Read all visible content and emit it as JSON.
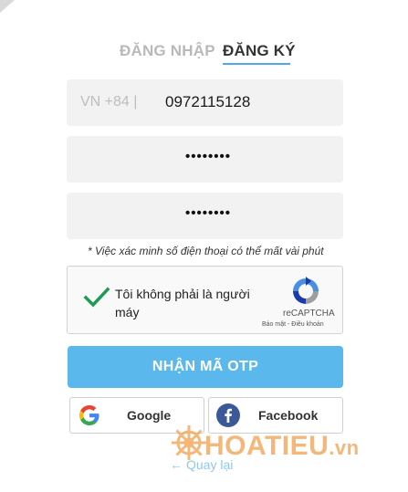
{
  "tabs": [
    {
      "label": "ĐĂNG NHẬP"
    },
    {
      "label": "ĐĂNG KÝ"
    }
  ],
  "phone": {
    "prefix": "VN +84 |",
    "value": "0972115128"
  },
  "password": {
    "masked": "••••••••"
  },
  "confirm_password": {
    "masked": "••••••••"
  },
  "note": "* Việc xác minh số điện thoại có thể mất vài phút",
  "captcha": {
    "label": "Tôi không phải là người máy",
    "brand": "reCAPTCHA",
    "links": "Bảo mật - Điều khoản"
  },
  "otp_button": "NHẬN MÃ OTP",
  "social": {
    "google": "Google",
    "facebook": "Facebook"
  },
  "back_link": "Quay lại",
  "watermark": {
    "name": "HOATIEU",
    "tld": ".vn"
  },
  "colors": {
    "accent": "#5bb8ed",
    "tab_underline": "#4ea9e6",
    "check_green": "#1e9b54",
    "facebook_blue": "#3b5998",
    "watermark_orange": "#f2a65a"
  }
}
